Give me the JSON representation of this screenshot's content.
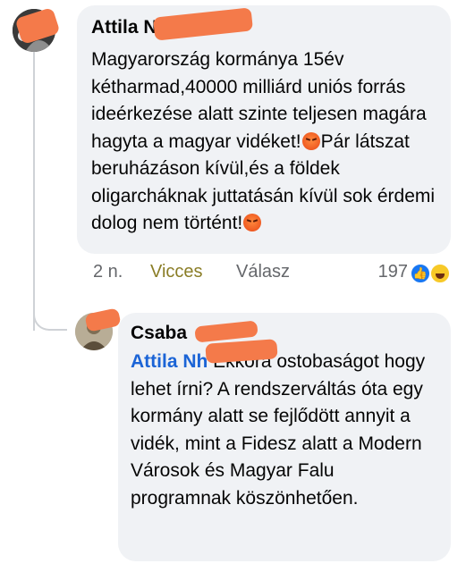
{
  "comment": {
    "author": "Attila N",
    "text_before_emoji_1": "Magyarország kormánya 15év kétharmad,40000 milliárd uniós forrás ideérkezése alatt szinte teljesen magára hagyta a magyar vidéket!",
    "text_between": "Pár látszat beruházáson kívül,és a földek oligarcháknak juttatásán kívül sok érdemi dolog nem történt!",
    "emoji_icon": "angry-face-icon",
    "time": "2 n.",
    "reaction_label": "Vicces",
    "reply_label": "Válasz",
    "reaction_count": "197",
    "reaction_icons": [
      "like-icon",
      "haha-icon"
    ]
  },
  "reply": {
    "author": "Csaba",
    "mention": "Attila N",
    "mention_suffix": "h",
    "text": "Ekkora ostobaságot hogy lehet írni? A rendszerváltás óta egy kormány alatt se fejlődött annyit a vidék, mint a Fidesz alatt a Modern Városok és Magyar Falu programnak köszönhetően."
  },
  "colors": {
    "bubble": "#f0f2f5",
    "mention": "#1b64d6",
    "reaction_active": "#8a7d26",
    "redaction": "#f47a4a"
  }
}
